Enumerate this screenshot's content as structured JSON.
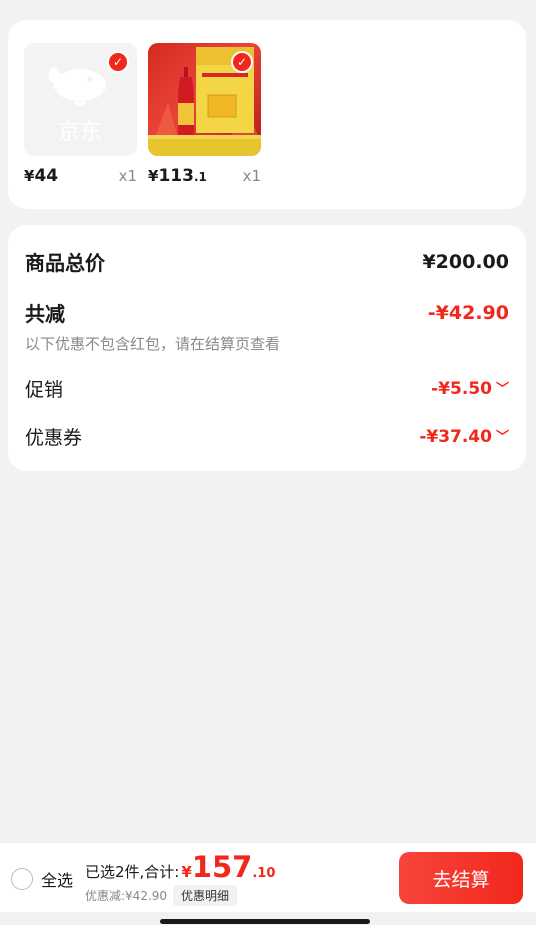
{
  "products": [
    {
      "image": "jd-placeholder-logo",
      "image_text": "京东",
      "checked": true,
      "price_symbol": "¥",
      "price_int": "44",
      "price_dec": "",
      "quantity": "x1"
    },
    {
      "image": "liquor-bottle-product-photo",
      "checked": true,
      "price_symbol": "¥",
      "price_int": "113",
      "price_dec": ".1",
      "quantity": "x1"
    }
  ],
  "summary": {
    "total_label": "商品总价",
    "total_value": "¥200.00",
    "reduction_label": "共减",
    "reduction_value": "-¥42.90",
    "note": "以下优惠不包含红包，请在结算页查看",
    "promotion_label": "促销",
    "promotion_value": "-¥5.50",
    "coupon_label": "优惠券",
    "coupon_value": "-¥37.40"
  },
  "bottom_bar": {
    "select_all_label": "全选",
    "selected_text": "已选2件,合计:",
    "total_symbol": "¥",
    "total_int": "157",
    "total_dec": ".10",
    "discount_text": "优惠减:¥42.90",
    "detail_button": "优惠明细",
    "checkout_button": "去结算"
  },
  "colors": {
    "accent": "#f2271c",
    "background": "#f2f2f2"
  }
}
